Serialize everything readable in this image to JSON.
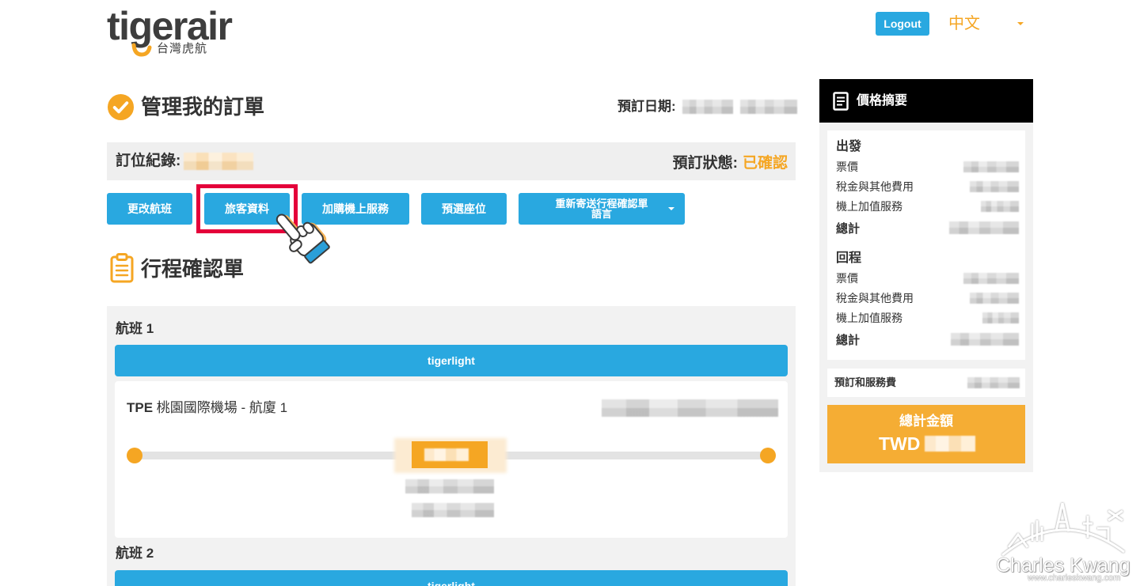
{
  "header": {
    "logo_text": "tigerair",
    "logo_subtitle": "台灣虎航",
    "logout_label": "Logout",
    "language_label": "中文"
  },
  "manage": {
    "title": "管理我的訂單",
    "booking_date_label": "預訂日期:",
    "booking_ref_label": "訂位紀錄:",
    "booking_status_label": "預訂狀態:",
    "booking_status_value": "已確認",
    "actions": [
      {
        "label": "更改航班"
      },
      {
        "label": "旅客資料"
      },
      {
        "label": "加購機上服務"
      },
      {
        "label": "預選座位"
      },
      {
        "label": "重新寄送行程確認單",
        "sublabel": "語言"
      }
    ]
  },
  "itinerary": {
    "title": "行程確認單",
    "flights": [
      {
        "label": "航班 1",
        "fare_brand": "tigerlight",
        "origin_code": "TPE",
        "origin_name": "桃園國際機場 - 航廈 1"
      },
      {
        "label": "航班 2",
        "fare_brand": "tigerlight"
      }
    ]
  },
  "price_summary": {
    "title": "價格摘要",
    "departure": {
      "heading": "出發",
      "fare": "票價",
      "taxes": "稅金與其他費用",
      "addons": "機上加值服務",
      "total": "總計"
    },
    "return": {
      "heading": "回程",
      "fare": "票價",
      "taxes": "稅金與其他費用",
      "addons": "機上加值服務",
      "total": "總計"
    },
    "service_fee_label": "預訂和服務費",
    "grand_total_label": "總計金額",
    "currency": "TWD"
  },
  "watermark": {
    "name": "Charles Kwang",
    "url": "www.charleskwang.com"
  },
  "icons": {
    "status": "check-circle-icon",
    "itinerary": "clipboard-icon",
    "summary": "document-icon",
    "cursor": "pointer-hand-icon",
    "dropdown": "chevron-down-icon"
  },
  "colors": {
    "brand_blue": "#29a8e0",
    "brand_orange": "#f5a623",
    "highlight_red": "#e4003a",
    "panel_gray": "#f2f2f2",
    "summary_header": "#000000"
  }
}
